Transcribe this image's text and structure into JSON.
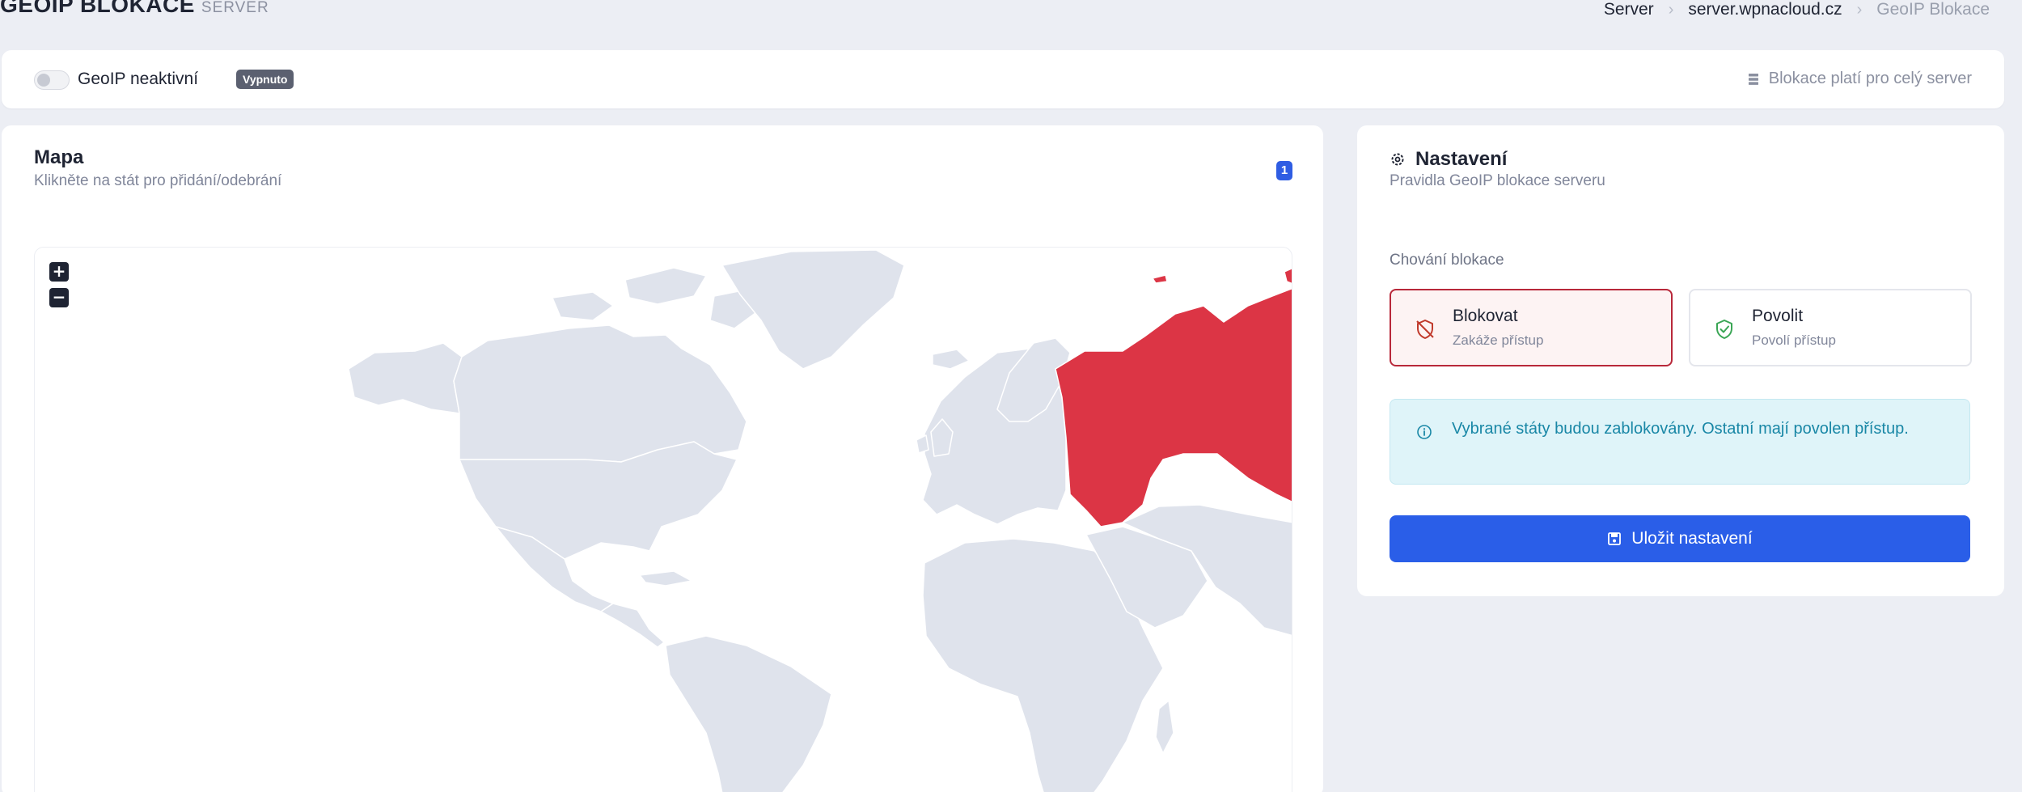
{
  "header": {
    "title": "GEOIP BLOKACE",
    "subtitle": "SERVER",
    "breadcrumbs": [
      "Server",
      "server.wpnacloud.cz",
      "GeoIP Blokace"
    ]
  },
  "topbar": {
    "toggle_state": "off",
    "status_label": "GeoIP neaktivní",
    "status_badge": "Vypnuto",
    "scope_note": "Blokace platí pro celý server"
  },
  "map": {
    "title": "Mapa",
    "subtitle": "Klikněte na stát pro přidání/odebrání",
    "selected_count": "1",
    "zoom_in": "+",
    "zoom_out": "−",
    "selected_country_color": "#dc3545",
    "country_color": "#dfe3ec"
  },
  "settings": {
    "title": "Nastavení",
    "subtitle": "Pravidla GeoIP blokace serveru",
    "behavior_label": "Chování blokace",
    "options": [
      {
        "title": "Blokovat",
        "desc": "Zakáže přístup",
        "icon": "shield-off-icon",
        "selected": true
      },
      {
        "title": "Povolit",
        "desc": "Povolí přístup",
        "icon": "shield-check-icon",
        "selected": false
      }
    ],
    "info_text": "Vybrané státy budou zablokovány. Ostatní mají povolen přístup.",
    "save_label": "Uložit nastavení"
  },
  "colors": {
    "accent": "#2a5ee8",
    "block": "#b8283a",
    "allow": "#3aa655",
    "info": "#1987a6"
  }
}
